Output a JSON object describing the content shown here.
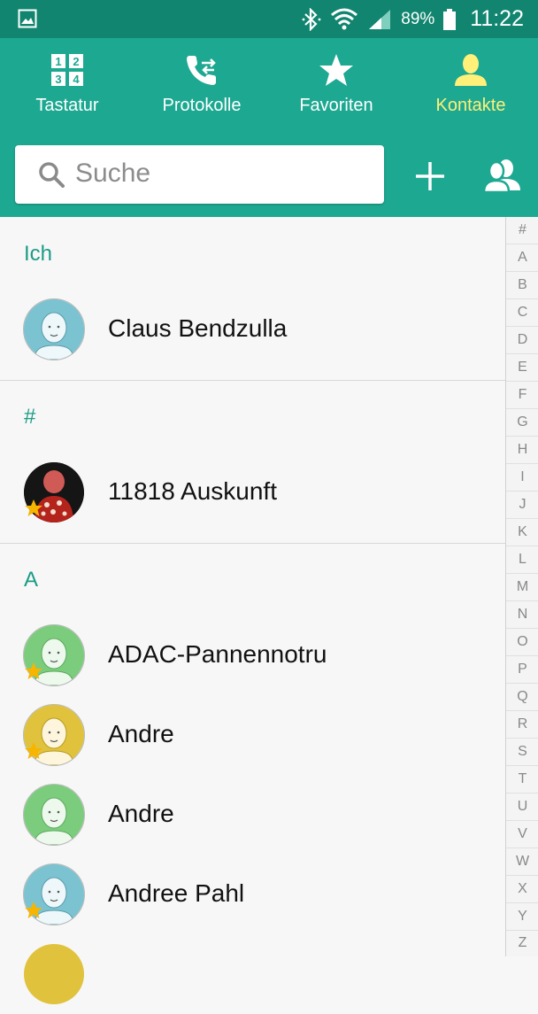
{
  "status_bar": {
    "battery": "89%",
    "time": "11:22",
    "icons": [
      "gallery-icon",
      "bluetooth-icon",
      "wifi-icon",
      "signal-icon",
      "battery-icon"
    ]
  },
  "tabs": [
    {
      "label": "Tastatur",
      "icon": "dialpad-icon",
      "active": false
    },
    {
      "label": "Protokolle",
      "icon": "call-log-icon",
      "active": false
    },
    {
      "label": "Favoriten",
      "icon": "star-icon",
      "active": false
    },
    {
      "label": "Kontakte",
      "icon": "contact-icon",
      "active": true
    }
  ],
  "search": {
    "placeholder": "Suche"
  },
  "sections": [
    {
      "header": "Ich",
      "contacts": [
        {
          "name": "Claus Bendzulla",
          "avatar": "blue",
          "favorite": false
        }
      ]
    },
    {
      "header": "#",
      "contacts": [
        {
          "name": "11818 Auskunft",
          "avatar": "photo",
          "favorite": true
        }
      ]
    },
    {
      "header": "A",
      "contacts": [
        {
          "name": "ADAC-Pannennotru",
          "avatar": "green",
          "favorite": true
        },
        {
          "name": "Andre",
          "avatar": "yellow",
          "favorite": true
        },
        {
          "name": "Andre",
          "avatar": "green",
          "favorite": false
        },
        {
          "name": "Andree Pahl",
          "avatar": "blue",
          "favorite": true
        }
      ]
    }
  ],
  "index_letters": [
    "#",
    "A",
    "B",
    "C",
    "D",
    "E",
    "F",
    "G",
    "H",
    "I",
    "J",
    "K",
    "L",
    "M",
    "N",
    "O",
    "P",
    "Q",
    "R",
    "S",
    "T",
    "U",
    "V",
    "W",
    "X",
    "Y",
    "Z"
  ],
  "colors": {
    "status_bar": "#11856f",
    "header": "#1da891",
    "active_tab": "#fff07a",
    "section_header": "#1b9c86",
    "avatar_blue": "#7cc3d1",
    "avatar_green": "#7ccc7e",
    "avatar_yellow": "#e0c23d",
    "star": "#f7b500"
  }
}
